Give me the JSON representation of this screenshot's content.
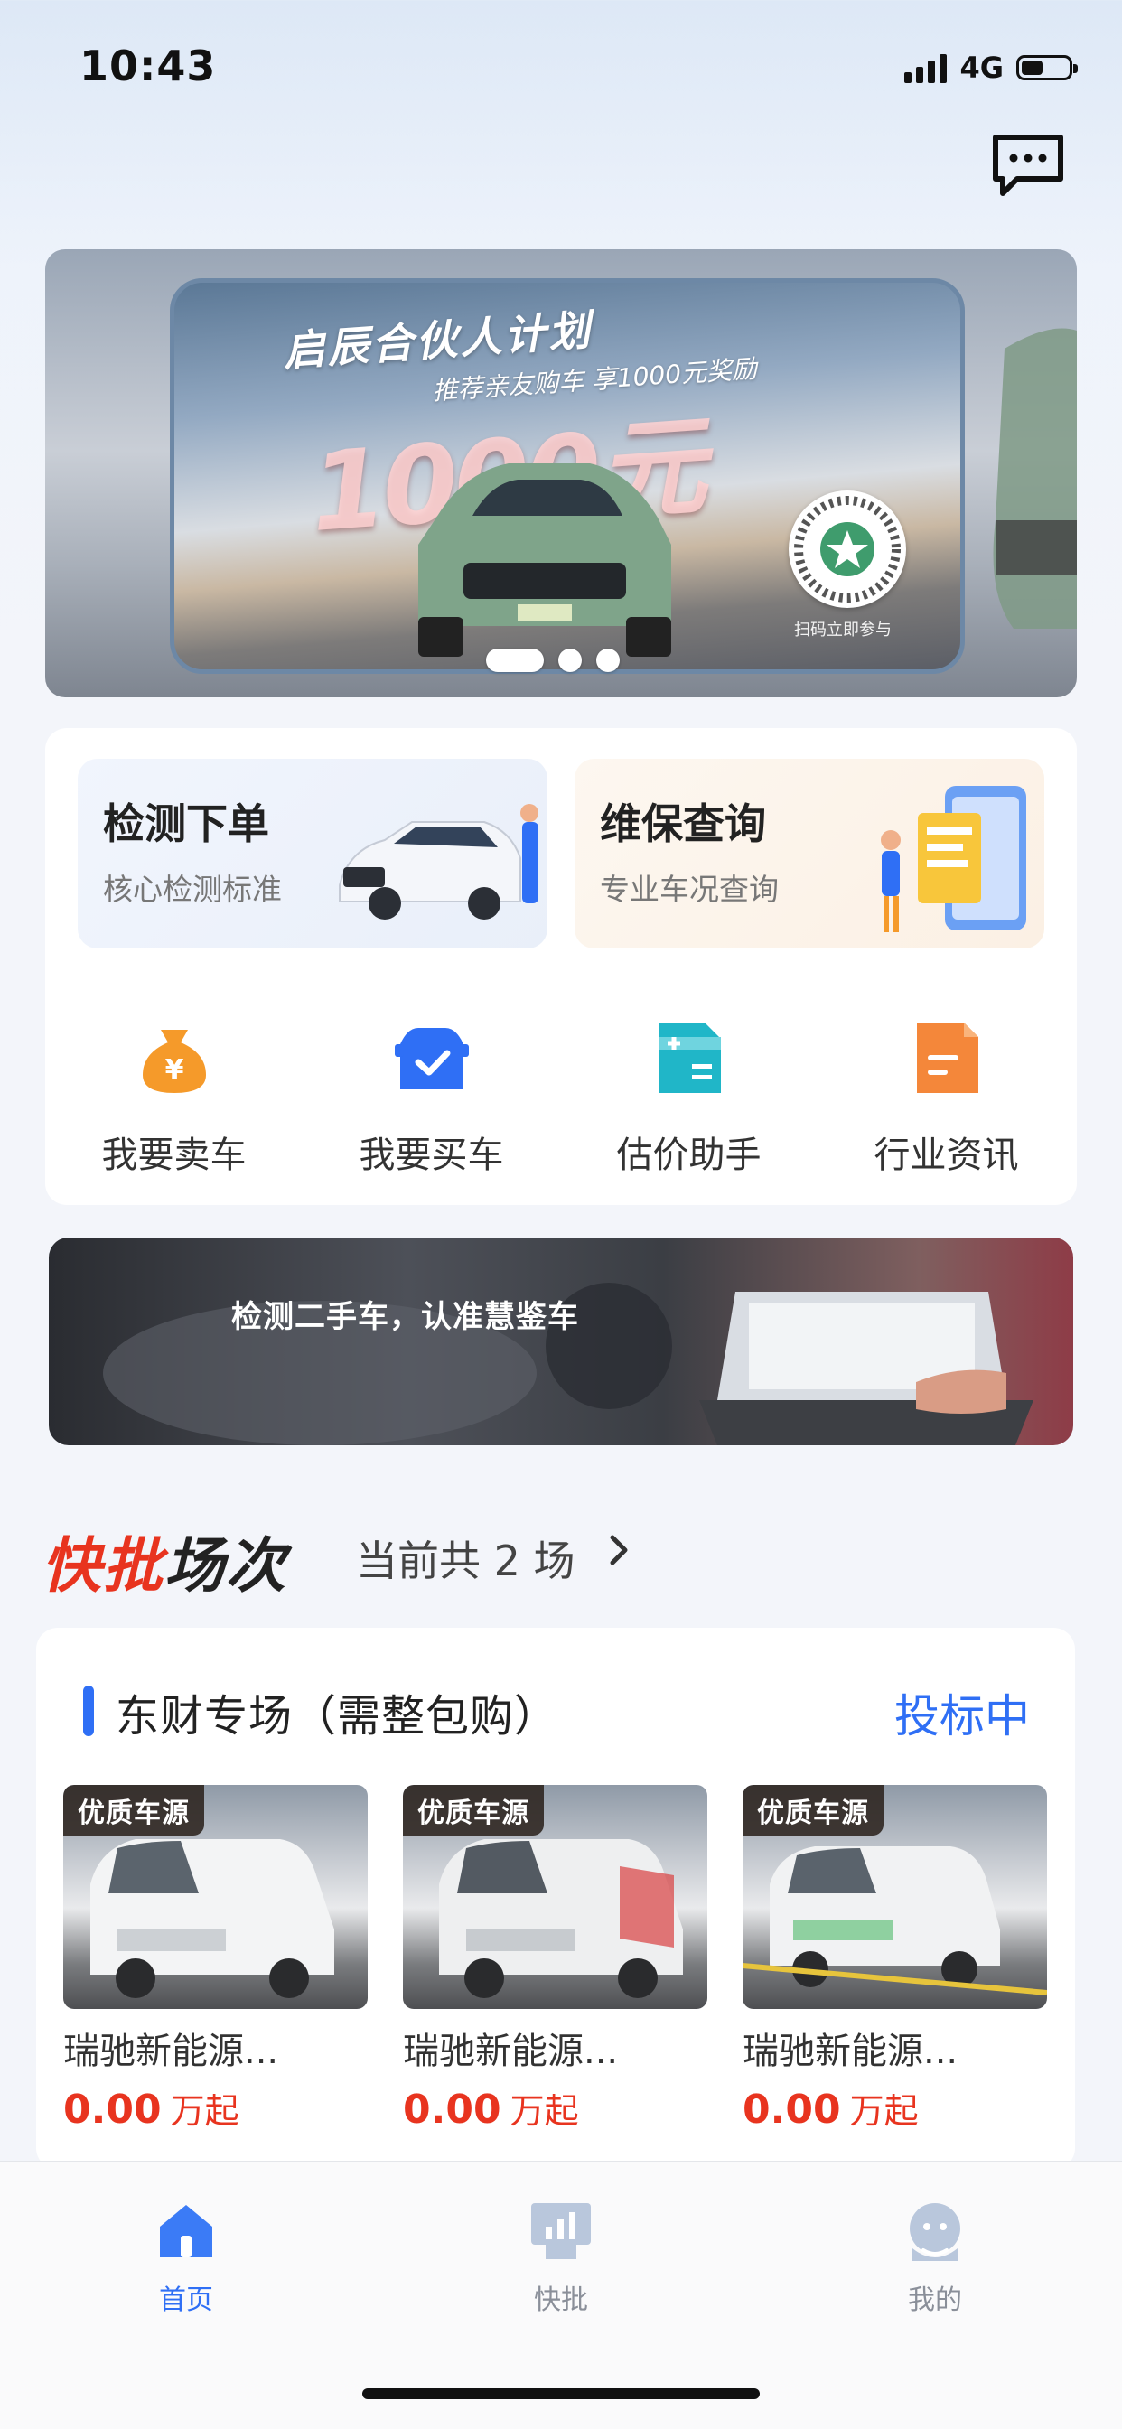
{
  "status_bar": {
    "time": "10:43",
    "network": "4G",
    "battery_level": 0.45
  },
  "banner": {
    "title": "启辰合伙人计划",
    "subtitle": "推荐亲友购车 享1000元奖励",
    "big_text": "1000元",
    "qr_label": "扫码立即参与",
    "page_count": 3,
    "active_page": 1
  },
  "services": {
    "cards": [
      {
        "title": "检测下单",
        "subtitle": "核心检测标准"
      },
      {
        "title": "维保查询",
        "subtitle": "专业车况查询"
      }
    ],
    "quick": [
      {
        "label": "我要卖车",
        "icon": "money-bag-icon",
        "color": "#f59a2a"
      },
      {
        "label": "我要买车",
        "icon": "car-check-icon",
        "color": "#2f6ff5"
      },
      {
        "label": "估价助手",
        "icon": "calculator-icon",
        "color": "#20b6c8"
      },
      {
        "label": "行业资讯",
        "icon": "news-icon",
        "color": "#f4873a"
      }
    ]
  },
  "promo": {
    "text": "检测二手车，认准慧鉴车"
  },
  "kuaipi": {
    "title_red": "快批",
    "title_dark": "场次",
    "count_text": "当前共 2 场"
  },
  "auction": {
    "title": "东财专场（需整包购）",
    "status": "投标中",
    "cars": [
      {
        "badge": "优质车源",
        "name": "瑞驰新能源...",
        "price": "0.00",
        "unit": "万起"
      },
      {
        "badge": "优质车源",
        "name": "瑞驰新能源...",
        "price": "0.00",
        "unit": "万起"
      },
      {
        "badge": "优质车源",
        "name": "瑞驰新能源...",
        "price": "0.00",
        "unit": "万起"
      }
    ]
  },
  "tabbar": {
    "items": [
      {
        "label": "首页",
        "active": true
      },
      {
        "label": "快批",
        "active": false
      },
      {
        "label": "我的",
        "active": false
      }
    ],
    "active_color": "#2f6ff5",
    "inactive_color": "#8a8f99"
  }
}
